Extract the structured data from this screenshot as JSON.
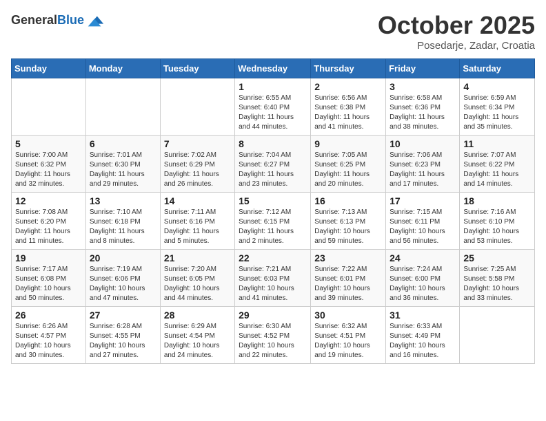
{
  "header": {
    "logo": {
      "general": "General",
      "blue": "Blue"
    },
    "title": "October 2025",
    "location": "Posedarje, Zadar, Croatia"
  },
  "weekdays": [
    "Sunday",
    "Monday",
    "Tuesday",
    "Wednesday",
    "Thursday",
    "Friday",
    "Saturday"
  ],
  "weeks": [
    [
      {
        "day": "",
        "info": ""
      },
      {
        "day": "",
        "info": ""
      },
      {
        "day": "",
        "info": ""
      },
      {
        "day": "1",
        "info": "Sunrise: 6:55 AM\nSunset: 6:40 PM\nDaylight: 11 hours\nand 44 minutes."
      },
      {
        "day": "2",
        "info": "Sunrise: 6:56 AM\nSunset: 6:38 PM\nDaylight: 11 hours\nand 41 minutes."
      },
      {
        "day": "3",
        "info": "Sunrise: 6:58 AM\nSunset: 6:36 PM\nDaylight: 11 hours\nand 38 minutes."
      },
      {
        "day": "4",
        "info": "Sunrise: 6:59 AM\nSunset: 6:34 PM\nDaylight: 11 hours\nand 35 minutes."
      }
    ],
    [
      {
        "day": "5",
        "info": "Sunrise: 7:00 AM\nSunset: 6:32 PM\nDaylight: 11 hours\nand 32 minutes."
      },
      {
        "day": "6",
        "info": "Sunrise: 7:01 AM\nSunset: 6:30 PM\nDaylight: 11 hours\nand 29 minutes."
      },
      {
        "day": "7",
        "info": "Sunrise: 7:02 AM\nSunset: 6:29 PM\nDaylight: 11 hours\nand 26 minutes."
      },
      {
        "day": "8",
        "info": "Sunrise: 7:04 AM\nSunset: 6:27 PM\nDaylight: 11 hours\nand 23 minutes."
      },
      {
        "day": "9",
        "info": "Sunrise: 7:05 AM\nSunset: 6:25 PM\nDaylight: 11 hours\nand 20 minutes."
      },
      {
        "day": "10",
        "info": "Sunrise: 7:06 AM\nSunset: 6:23 PM\nDaylight: 11 hours\nand 17 minutes."
      },
      {
        "day": "11",
        "info": "Sunrise: 7:07 AM\nSunset: 6:22 PM\nDaylight: 11 hours\nand 14 minutes."
      }
    ],
    [
      {
        "day": "12",
        "info": "Sunrise: 7:08 AM\nSunset: 6:20 PM\nDaylight: 11 hours\nand 11 minutes."
      },
      {
        "day": "13",
        "info": "Sunrise: 7:10 AM\nSunset: 6:18 PM\nDaylight: 11 hours\nand 8 minutes."
      },
      {
        "day": "14",
        "info": "Sunrise: 7:11 AM\nSunset: 6:16 PM\nDaylight: 11 hours\nand 5 minutes."
      },
      {
        "day": "15",
        "info": "Sunrise: 7:12 AM\nSunset: 6:15 PM\nDaylight: 11 hours\nand 2 minutes."
      },
      {
        "day": "16",
        "info": "Sunrise: 7:13 AM\nSunset: 6:13 PM\nDaylight: 10 hours\nand 59 minutes."
      },
      {
        "day": "17",
        "info": "Sunrise: 7:15 AM\nSunset: 6:11 PM\nDaylight: 10 hours\nand 56 minutes."
      },
      {
        "day": "18",
        "info": "Sunrise: 7:16 AM\nSunset: 6:10 PM\nDaylight: 10 hours\nand 53 minutes."
      }
    ],
    [
      {
        "day": "19",
        "info": "Sunrise: 7:17 AM\nSunset: 6:08 PM\nDaylight: 10 hours\nand 50 minutes."
      },
      {
        "day": "20",
        "info": "Sunrise: 7:19 AM\nSunset: 6:06 PM\nDaylight: 10 hours\nand 47 minutes."
      },
      {
        "day": "21",
        "info": "Sunrise: 7:20 AM\nSunset: 6:05 PM\nDaylight: 10 hours\nand 44 minutes."
      },
      {
        "day": "22",
        "info": "Sunrise: 7:21 AM\nSunset: 6:03 PM\nDaylight: 10 hours\nand 41 minutes."
      },
      {
        "day": "23",
        "info": "Sunrise: 7:22 AM\nSunset: 6:01 PM\nDaylight: 10 hours\nand 39 minutes."
      },
      {
        "day": "24",
        "info": "Sunrise: 7:24 AM\nSunset: 6:00 PM\nDaylight: 10 hours\nand 36 minutes."
      },
      {
        "day": "25",
        "info": "Sunrise: 7:25 AM\nSunset: 5:58 PM\nDaylight: 10 hours\nand 33 minutes."
      }
    ],
    [
      {
        "day": "26",
        "info": "Sunrise: 6:26 AM\nSunset: 4:57 PM\nDaylight: 10 hours\nand 30 minutes."
      },
      {
        "day": "27",
        "info": "Sunrise: 6:28 AM\nSunset: 4:55 PM\nDaylight: 10 hours\nand 27 minutes."
      },
      {
        "day": "28",
        "info": "Sunrise: 6:29 AM\nSunset: 4:54 PM\nDaylight: 10 hours\nand 24 minutes."
      },
      {
        "day": "29",
        "info": "Sunrise: 6:30 AM\nSunset: 4:52 PM\nDaylight: 10 hours\nand 22 minutes."
      },
      {
        "day": "30",
        "info": "Sunrise: 6:32 AM\nSunset: 4:51 PM\nDaylight: 10 hours\nand 19 minutes."
      },
      {
        "day": "31",
        "info": "Sunrise: 6:33 AM\nSunset: 4:49 PM\nDaylight: 10 hours\nand 16 minutes."
      },
      {
        "day": "",
        "info": ""
      }
    ]
  ]
}
